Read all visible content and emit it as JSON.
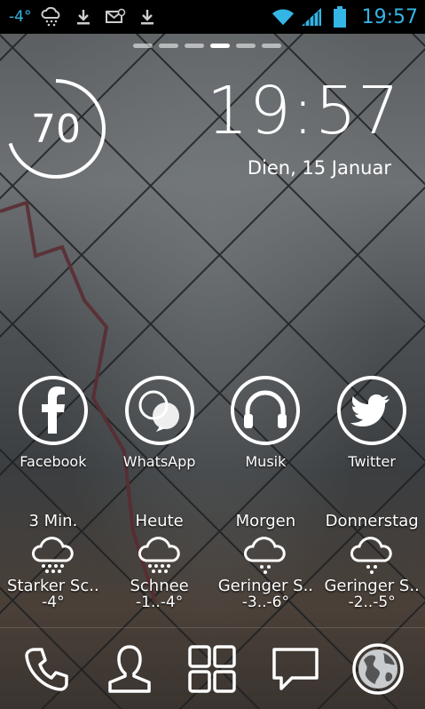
{
  "statusbar": {
    "temp": "-4°",
    "time": "19:57",
    "icons_left": [
      "snow-cloud-icon",
      "download-icon",
      "mail-icon",
      "download-icon"
    ],
    "icons_right": [
      "wifi-icon",
      "signal-icon",
      "battery-icon"
    ],
    "accent_color": "#33b5e5"
  },
  "home": {
    "page_count": 6,
    "active_page": 4,
    "battery_level": "70",
    "battery_fraction": 0.7,
    "clock": "19:57",
    "date": "Dien, 15 Januar"
  },
  "apps": [
    {
      "label": "Facebook",
      "icon": "facebook-icon"
    },
    {
      "label": "WhatsApp",
      "icon": "whatsapp-icon"
    },
    {
      "label": "Musik",
      "icon": "headphones-icon"
    },
    {
      "label": "Twitter",
      "icon": "twitter-bird-icon"
    }
  ],
  "weather": [
    {
      "day": "3 Min.",
      "desc": "Starker Sc..",
      "temp": "-4°"
    },
    {
      "day": "Heute",
      "desc": "Schnee",
      "temp": "-1..-4°"
    },
    {
      "day": "Morgen",
      "desc": "Geringer S..",
      "temp": "-3..-6°"
    },
    {
      "day": "Donnerstag",
      "desc": "Geringer S..",
      "temp": "-2..-5°"
    }
  ],
  "dock": [
    "phone-icon",
    "contacts-icon",
    "app-drawer-icon",
    "messaging-icon",
    "browser-globe-icon"
  ]
}
